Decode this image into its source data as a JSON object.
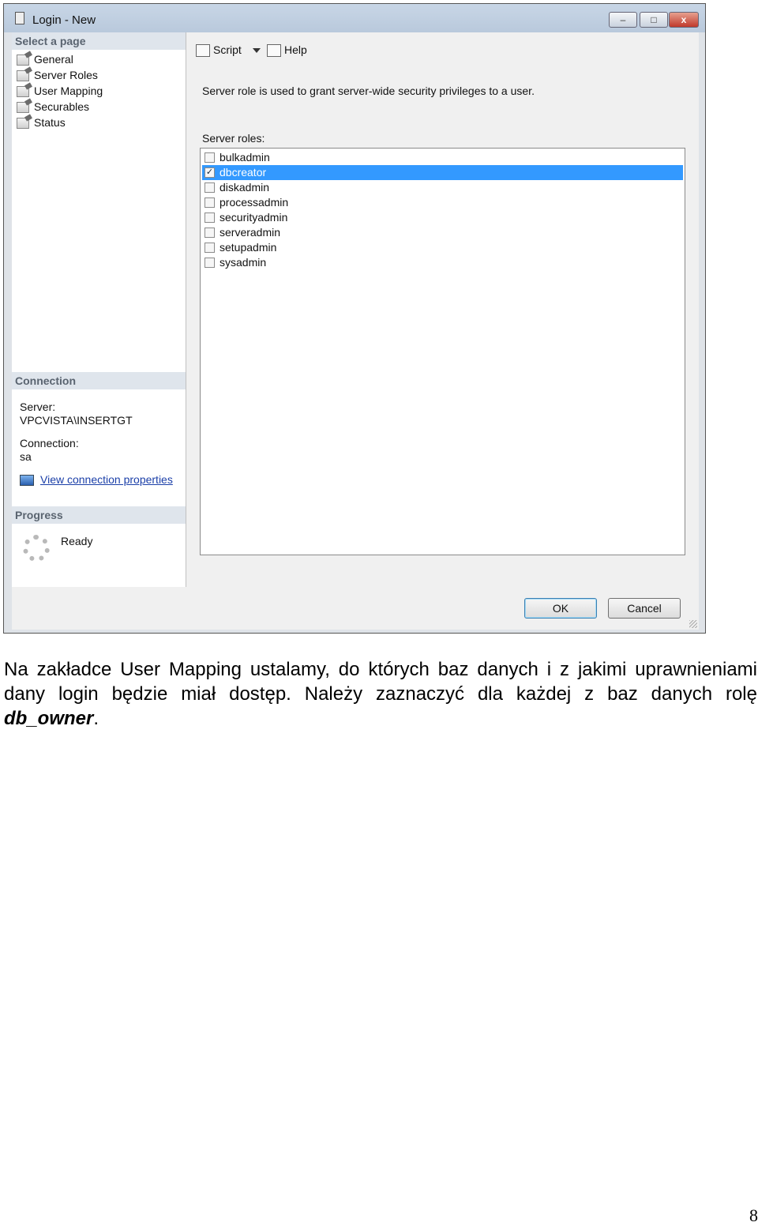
{
  "window": {
    "title": "Login - New",
    "buttons": {
      "minimize": "–",
      "maximize": "□",
      "close": "x"
    }
  },
  "sidebar": {
    "header": "Select a page",
    "items": [
      {
        "label": "General"
      },
      {
        "label": "Server Roles"
      },
      {
        "label": "User Mapping"
      },
      {
        "label": "Securables"
      },
      {
        "label": "Status"
      }
    ]
  },
  "connection": {
    "header": "Connection",
    "server_label": "Server:",
    "server_value": "VPCVISTA\\INSERTGT",
    "connection_label": "Connection:",
    "connection_value": "sa",
    "link": "View connection properties"
  },
  "progress": {
    "header": "Progress",
    "status": "Ready"
  },
  "toolbar": {
    "script": "Script",
    "help": "Help"
  },
  "main": {
    "description": "Server role is used to grant server-wide security privileges to a user.",
    "roles_label": "Server roles:",
    "roles": [
      {
        "name": "bulkadmin",
        "checked": false,
        "selected": false
      },
      {
        "name": "dbcreator",
        "checked": true,
        "selected": true
      },
      {
        "name": "diskadmin",
        "checked": false,
        "selected": false
      },
      {
        "name": "processadmin",
        "checked": false,
        "selected": false
      },
      {
        "name": "securityadmin",
        "checked": false,
        "selected": false
      },
      {
        "name": "serveradmin",
        "checked": false,
        "selected": false
      },
      {
        "name": "setupadmin",
        "checked": false,
        "selected": false
      },
      {
        "name": "sysadmin",
        "checked": false,
        "selected": false
      }
    ]
  },
  "dialog_buttons": {
    "ok": "OK",
    "cancel": "Cancel"
  },
  "document": {
    "paragraph_text": "Na zakładce User Mapping ustalamy, do których baz danych i z jakimi uprawnieniami dany login będzie miał dostęp. Należy zaznaczyć dla każdej z baz danych rolę ",
    "paragraph_emphasis": "db_owner",
    "paragraph_end": ".",
    "page_number": "8"
  }
}
